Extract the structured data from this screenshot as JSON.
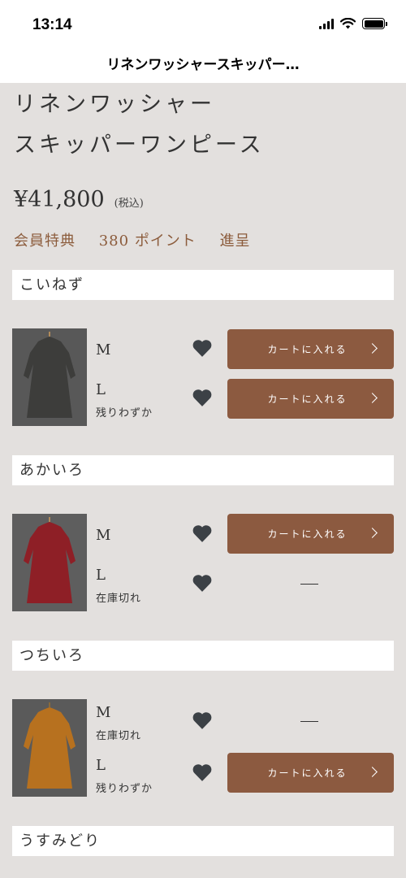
{
  "status_bar": {
    "time": "13:14"
  },
  "nav": {
    "title": "リネンワッシャースキッパー…"
  },
  "product": {
    "title_line1": "リネンワッシャー",
    "title_line2": "スキッパーワンピース",
    "price": "¥41,800",
    "tax_note": "(税込)",
    "points_label": "会員特典",
    "points_value": "380 ポイント",
    "points_suffix": "進呈"
  },
  "colors": [
    {
      "name": "こいねず",
      "dress_color": "#3d3d3b",
      "sizes": [
        {
          "size": "M",
          "note": "",
          "button": "カートに入れる"
        },
        {
          "size": "L",
          "note": "残りわずか",
          "button": "カートに入れる"
        }
      ]
    },
    {
      "name": "あかいろ",
      "dress_color": "#8e1f26",
      "sizes": [
        {
          "size": "M",
          "note": "",
          "button": "カートに入れる"
        },
        {
          "size": "L",
          "note": "在庫切れ",
          "button": "—"
        }
      ]
    },
    {
      "name": "つちいろ",
      "dress_color": "#b7711f",
      "sizes": [
        {
          "size": "M",
          "note": "在庫切れ",
          "button": "—"
        },
        {
          "size": "L",
          "note": "残りわずか",
          "button": "カートに入れる"
        }
      ]
    },
    {
      "name": "うすみどり"
    }
  ],
  "theme": {
    "accent": "#8c5a40",
    "points_color": "#8c5c3c",
    "background": "#e3e0de"
  }
}
